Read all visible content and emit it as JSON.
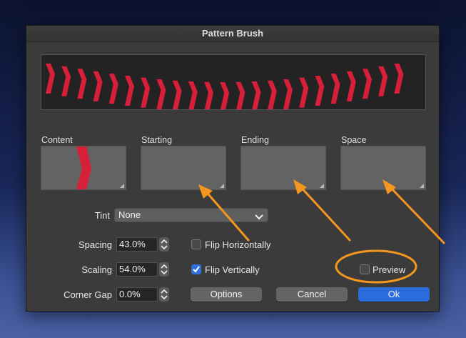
{
  "dialog": {
    "title": "Pattern Brush",
    "slots": [
      {
        "label": "Content"
      },
      {
        "label": "Starting"
      },
      {
        "label": "Ending"
      },
      {
        "label": "Space"
      }
    ],
    "tint": {
      "label": "Tint",
      "value": "None"
    },
    "spacing": {
      "label": "Spacing",
      "value": "43.0%"
    },
    "scaling": {
      "label": "Scaling",
      "value": "54.0%"
    },
    "corner_gap": {
      "label": "Corner Gap",
      "value": "0.0%"
    },
    "flip_horizontally": {
      "label": "Flip Horizontally",
      "checked": false
    },
    "flip_vertically": {
      "label": "Flip Vertically",
      "checked": true
    },
    "preview": {
      "label": "Preview",
      "checked": false
    },
    "buttons": {
      "options": "Options",
      "cancel": "Cancel",
      "ok": "Ok"
    }
  },
  "colors": {
    "brush_red": "#d81f3a",
    "annotation_orange": "#f5961e",
    "primary_blue": "#2d6cdf"
  }
}
